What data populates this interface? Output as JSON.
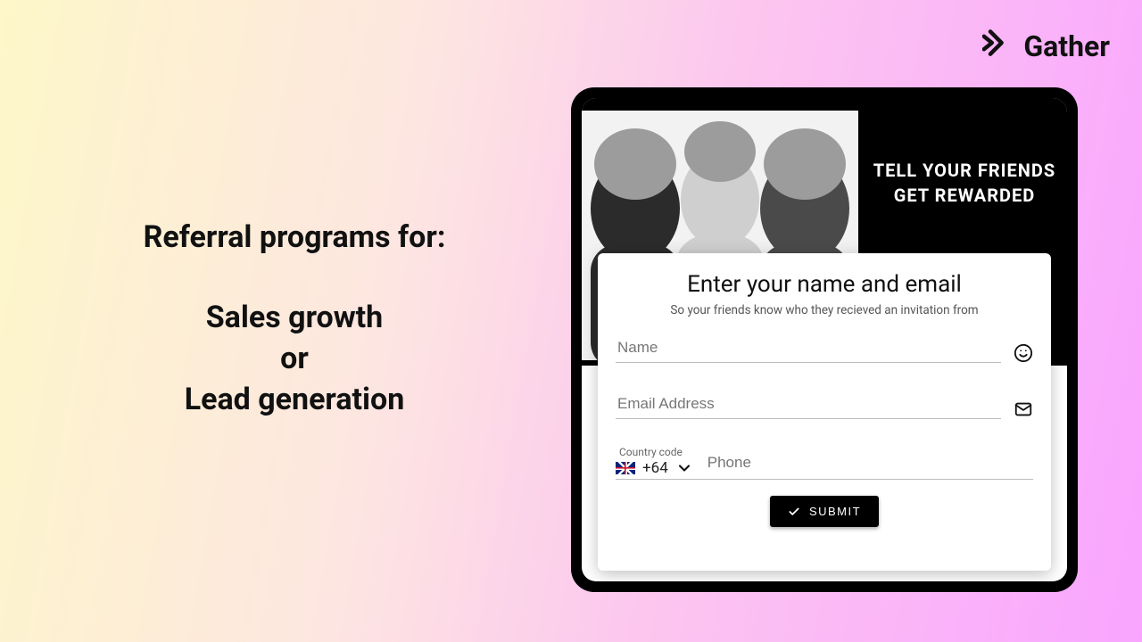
{
  "brand": {
    "name": "Gather"
  },
  "left": {
    "heading": "Referral programs for:",
    "line1": "Sales growth",
    "line2": "or",
    "line3": "Lead generation"
  },
  "hero": {
    "line1": "TELL YOUR FRIENDS",
    "line2": "GET REWARDED"
  },
  "form": {
    "title": "Enter your name and email",
    "subtitle": "So your friends know who they recieved an invitation from",
    "name_placeholder": "Name",
    "email_placeholder": "Email Address",
    "country_code_label": "Country code",
    "country_code_value": "+64",
    "phone_placeholder": "Phone",
    "submit_label": "SUBMIT"
  }
}
